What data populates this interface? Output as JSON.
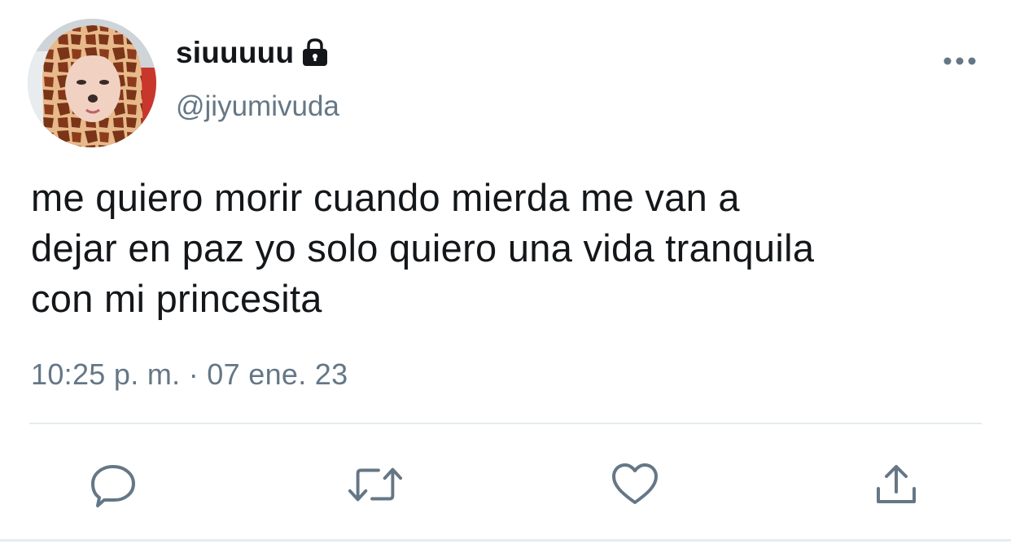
{
  "tweet": {
    "display_name": "siuuuuu",
    "handle": "@jiyumivuda",
    "text": "me quiero morir cuando mierda me van a\ndejar en paz yo solo quiero una vida tranquila\ncon mi princesita",
    "timestamp": "10:25 p. m. · 07 ene. 23"
  },
  "icons": {
    "lock": "lock-icon",
    "more": "more-dots-icon",
    "reply": "reply-icon",
    "retweet": "retweet-icon",
    "like": "heart-icon",
    "share": "share-icon"
  },
  "colors": {
    "text": "#14171a",
    "secondary": "#657786",
    "divider": "#e6ecf0",
    "icon": "#657786"
  }
}
